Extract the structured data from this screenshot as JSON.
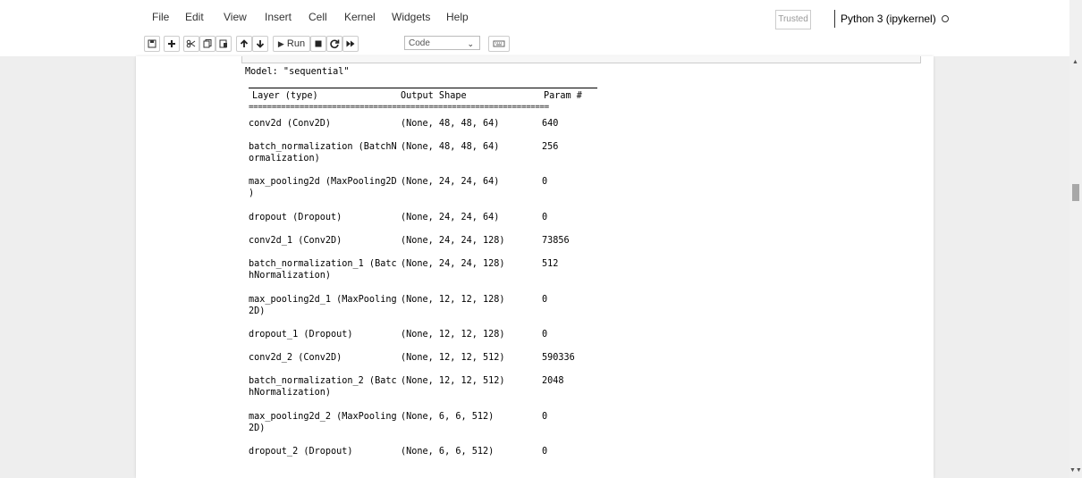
{
  "menu": {
    "items": [
      "File",
      "Edit",
      "View",
      "Insert",
      "Cell",
      "Kernel",
      "Widgets",
      "Help"
    ]
  },
  "status": {
    "trusted": "Trusted",
    "kernel": "Python 3 (ipykernel)"
  },
  "toolbar": {
    "run_label": "Run",
    "cell_type": "Code",
    "icons": [
      "save-icon",
      "plus-icon",
      "cut-icon",
      "copy-icon",
      "paste-icon",
      "arrow-up-icon",
      "arrow-down-icon",
      "play-icon",
      "stop-icon",
      "restart-icon",
      "fast-forward-icon",
      "keyboard-icon"
    ]
  },
  "output": {
    "model_title": "Model: \"sequential\"",
    "headers": {
      "layer": "Layer (type)",
      "shape": "Output Shape",
      "params": "Param #"
    },
    "separator": "=================================================================",
    "rows": [
      {
        "layer": "conv2d (Conv2D)",
        "shape": "(None, 48, 48, 64)",
        "params": "640"
      },
      {
        "layer": "batch_normalization (BatchN\normalization)",
        "shape": "(None, 48, 48, 64)",
        "params": "256"
      },
      {
        "layer": "max_pooling2d (MaxPooling2D\n)",
        "shape": "(None, 24, 24, 64)",
        "params": "0"
      },
      {
        "layer": "dropout (Dropout)",
        "shape": "(None, 24, 24, 64)",
        "params": "0"
      },
      {
        "layer": "conv2d_1 (Conv2D)",
        "shape": "(None, 24, 24, 128)",
        "params": "73856"
      },
      {
        "layer": "batch_normalization_1 (Batc\nhNormalization)",
        "shape": "(None, 24, 24, 128)",
        "params": "512"
      },
      {
        "layer": "max_pooling2d_1 (MaxPooling\n2D)",
        "shape": "(None, 12, 12, 128)",
        "params": "0"
      },
      {
        "layer": "dropout_1 (Dropout)",
        "shape": "(None, 12, 12, 128)",
        "params": "0"
      },
      {
        "layer": "conv2d_2 (Conv2D)",
        "shape": "(None, 12, 12, 512)",
        "params": "590336"
      },
      {
        "layer": "batch_normalization_2 (Batc\nhNormalization)",
        "shape": "(None, 12, 12, 512)",
        "params": "2048"
      },
      {
        "layer": "max_pooling2d_2 (MaxPooling\n2D)",
        "shape": "(None, 6, 6, 512)",
        "params": "0"
      },
      {
        "layer": "dropout_2 (Dropout)",
        "shape": "(None, 6, 6, 512)",
        "params": "0"
      }
    ]
  }
}
